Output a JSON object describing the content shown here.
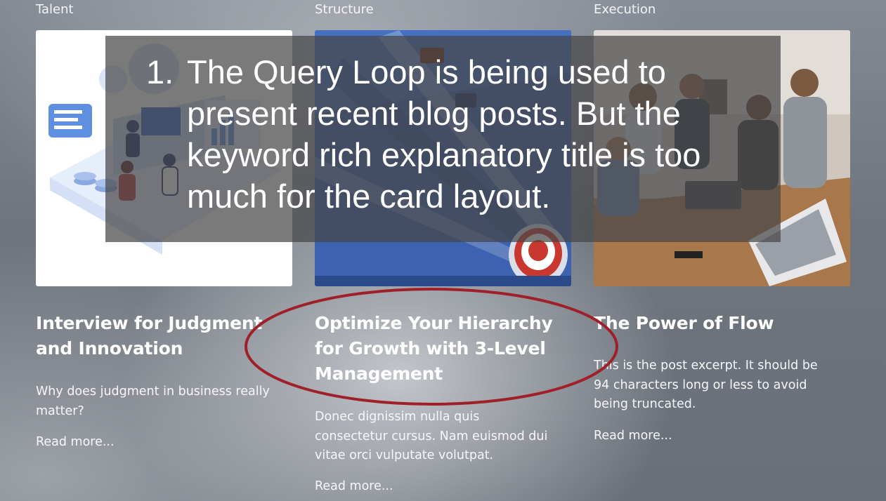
{
  "posts": [
    {
      "category": "Talent",
      "title": "Interview for Judgment and Innovation",
      "excerpt": "Why does judgment in business really matter?",
      "read_more": "Read more..."
    },
    {
      "category": "Structure",
      "title": "Optimize Your Hierarchy for Growth with 3-Level Management",
      "excerpt": "Donec dignissim nulla quis consectetur cursus. Nam euismod dui vitae orci vulputate volutpat.",
      "read_more": "Read more..."
    },
    {
      "category": "Execution",
      "title": "The Power of Flow",
      "excerpt": "This is the post excerpt. It should be 94 characters long or less to avoid being truncated.",
      "read_more": "Read more..."
    }
  ],
  "annotation": {
    "number": "1.",
    "text": "The Query Loop is being used to present recent blog posts. But the keyword rich explanatory title is too much for the card layout."
  },
  "colors": {
    "highlight_ellipse": "#a0202a",
    "overlay": "#464648"
  },
  "icons": [
    "meeting-illustration",
    "target-arrows-illustration",
    "team-meeting-photo"
  ]
}
